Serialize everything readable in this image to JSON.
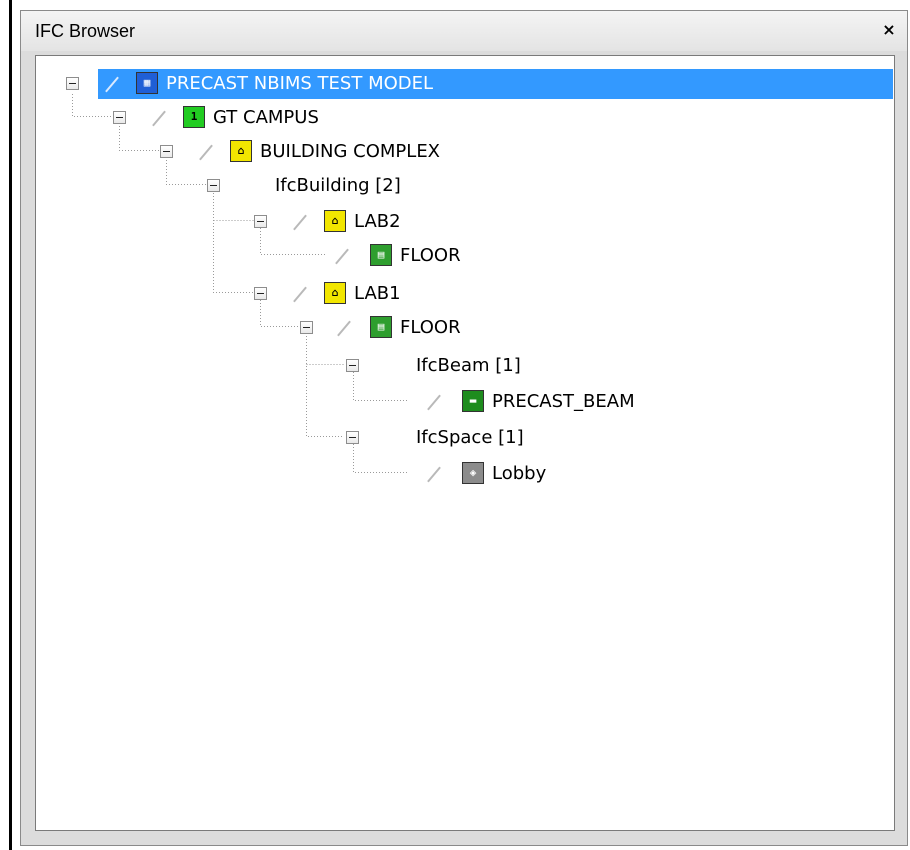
{
  "window": {
    "title": "IFC Browser",
    "close_glyph": "×"
  },
  "tree": [
    {
      "label": "PRECAST NBIMS TEST MODEL",
      "icon": "project-icon",
      "selected": true
    },
    {
      "label": "GT CAMPUS",
      "icon": "site-icon"
    },
    {
      "label": "BUILDING COMPLEX",
      "icon": "building-icon"
    },
    {
      "label": "IfcBuilding [2]",
      "icon": ""
    },
    {
      "label": "LAB2",
      "icon": "building-icon"
    },
    {
      "label": "FLOOR",
      "icon": "storey-icon"
    },
    {
      "label": "LAB1",
      "icon": "building-icon"
    },
    {
      "label": "FLOOR",
      "icon": "storey-icon"
    },
    {
      "label": "IfcBeam [1]",
      "icon": ""
    },
    {
      "label": "PRECAST_BEAM",
      "icon": "beam-icon"
    },
    {
      "label": "IfcSpace [1]",
      "icon": ""
    },
    {
      "label": "Lobby",
      "icon": "space-icon"
    }
  ],
  "colors": {
    "selection": "#3399ff",
    "project_icon": "#1f5fd6",
    "site_icon": "#22cc22",
    "building_icon": "#f2e600",
    "storey_icon": "#2e9e2e",
    "beam_icon": "#1e8c1e",
    "space_icon": "#8c8c8c"
  }
}
